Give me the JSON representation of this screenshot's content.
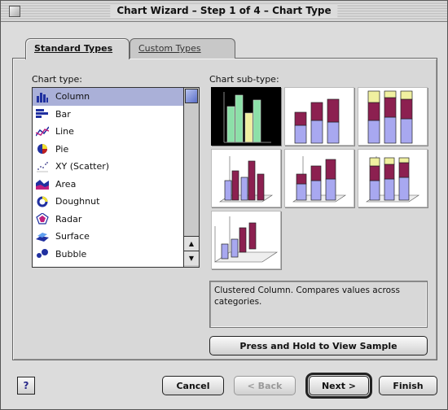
{
  "window": {
    "title": "Chart Wizard – Step 1 of 4 – Chart Type"
  },
  "tabs": [
    {
      "label": "Standard Types",
      "active": true
    },
    {
      "label": "Custom Types",
      "active": false
    }
  ],
  "chart_type": {
    "label": "Chart type:",
    "selected": "Column",
    "items": [
      {
        "label": "Column",
        "icon": "column-chart-icon"
      },
      {
        "label": "Bar",
        "icon": "bar-chart-icon"
      },
      {
        "label": "Line",
        "icon": "line-chart-icon"
      },
      {
        "label": "Pie",
        "icon": "pie-chart-icon"
      },
      {
        "label": "XY (Scatter)",
        "icon": "scatter-chart-icon"
      },
      {
        "label": "Area",
        "icon": "area-chart-icon"
      },
      {
        "label": "Doughnut",
        "icon": "doughnut-chart-icon"
      },
      {
        "label": "Radar",
        "icon": "radar-chart-icon"
      },
      {
        "label": "Surface",
        "icon": "surface-chart-icon"
      },
      {
        "label": "Bubble",
        "icon": "bubble-chart-icon"
      }
    ]
  },
  "chart_subtype": {
    "label": "Chart sub-type:",
    "options": [
      {
        "name": "clustered-column",
        "selected": true
      },
      {
        "name": "stacked-column",
        "selected": false
      },
      {
        "name": "100-stacked-column",
        "selected": false
      },
      {
        "name": "3d-clustered-column",
        "selected": false
      },
      {
        "name": "3d-stacked-column",
        "selected": false
      },
      {
        "name": "3d-100-stacked-column",
        "selected": false
      },
      {
        "name": "3d-column",
        "selected": false
      }
    ],
    "description": "Clustered Column. Compares values across categories."
  },
  "buttons": {
    "sample": "Press and Hold to View Sample",
    "cancel": "Cancel",
    "back": "< Back",
    "next": "Next >",
    "finish": "Finish",
    "help": "?"
  },
  "colors": {
    "window_bg": "#dcdcdc",
    "selection": "#aab0d8",
    "bar_green": "#8ce0a8",
    "bar_yellow": "#f0f0a0",
    "bar_maroon": "#8c2050",
    "bar_blue": "#a8a8f0"
  }
}
